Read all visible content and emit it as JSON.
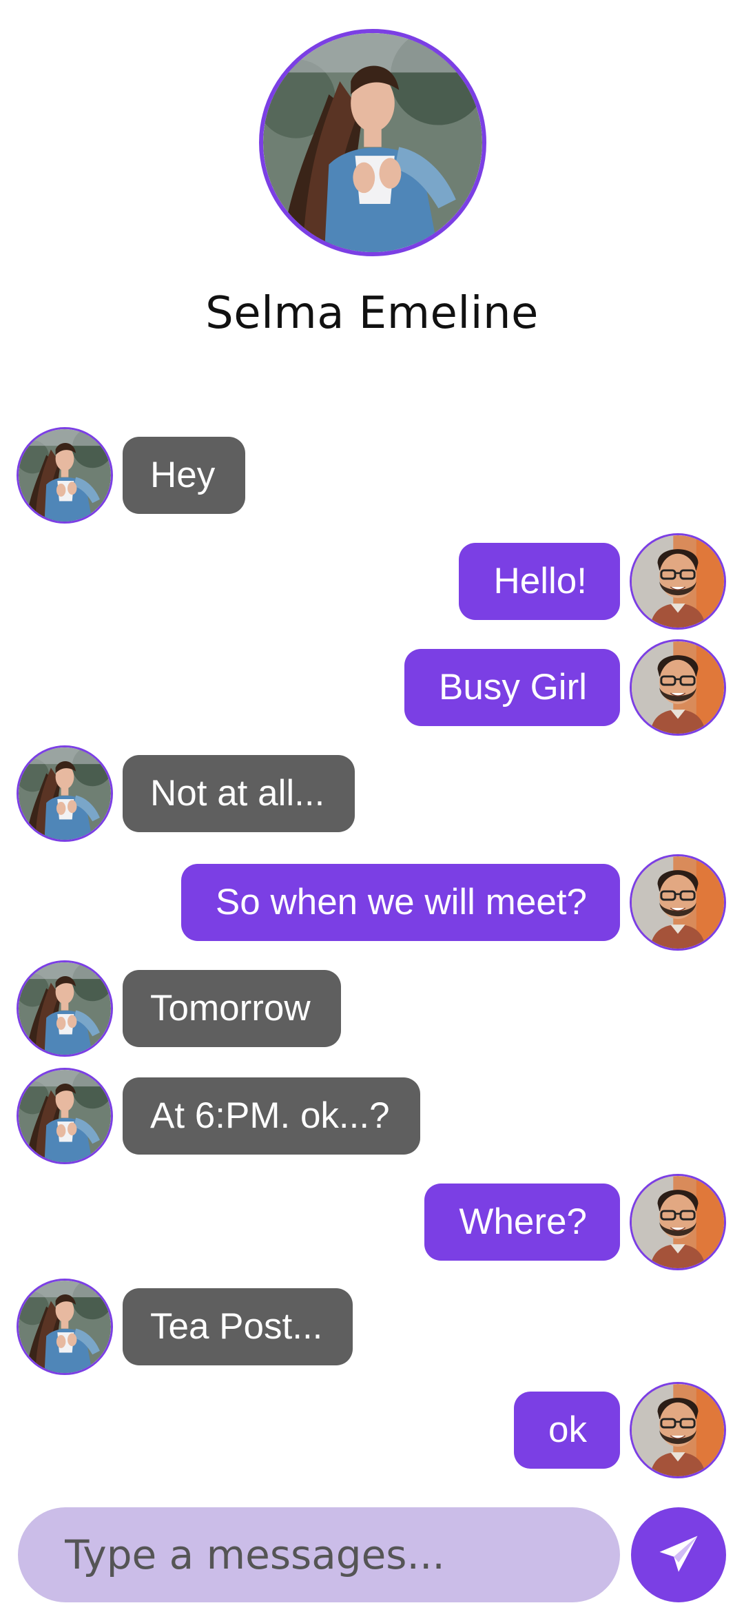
{
  "contact": {
    "name": "Selma Emeline"
  },
  "colors": {
    "accent": "#7b3fe4",
    "incoming_bubble": "#5f5f5f",
    "input_background": "#cbbde8"
  },
  "messages": [
    {
      "direction": "incoming",
      "text": "Hey"
    },
    {
      "direction": "outgoing",
      "text": "Hello!"
    },
    {
      "direction": "outgoing",
      "text": "Busy Girl"
    },
    {
      "direction": "incoming",
      "text": "Not at all..."
    },
    {
      "direction": "outgoing",
      "text": "So when we will meet?"
    },
    {
      "direction": "incoming",
      "text": "Tomorrow"
    },
    {
      "direction": "incoming",
      "text": "At 6:PM. ok...?"
    },
    {
      "direction": "outgoing",
      "text": "Where?"
    },
    {
      "direction": "incoming",
      "text": "Tea Post..."
    },
    {
      "direction": "outgoing",
      "text": "ok"
    }
  ],
  "composer": {
    "placeholder": "Type a messages...",
    "send_icon": "paper-plane-icon"
  }
}
